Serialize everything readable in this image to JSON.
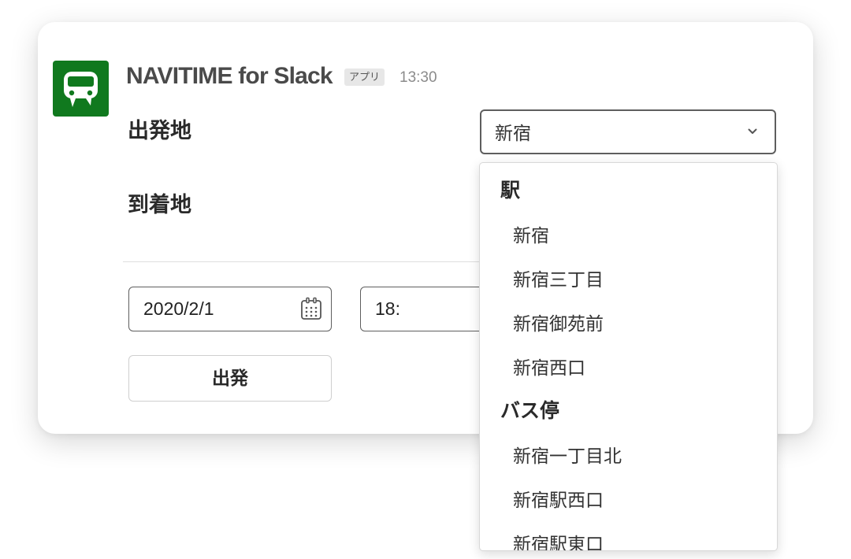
{
  "message": {
    "app_name": "NAVITIME for Slack",
    "app_badge": "アプリ",
    "timestamp": "13:30",
    "app_icon": "train-icon",
    "accent_color": "#10791e"
  },
  "form": {
    "departure_label": "出発地",
    "arrival_label": "到着地",
    "departure_select": {
      "value": "新宿",
      "icon": "chevron-down-icon"
    },
    "date_value": "2020/2/1",
    "date_icon": "calendar-icon",
    "time_value": "18:",
    "submit_label": "出発"
  },
  "dropdown": {
    "groups": [
      {
        "header": "駅",
        "options": [
          "新宿",
          "新宿三丁目",
          "新宿御苑前",
          "新宿西口"
        ]
      },
      {
        "header": "バス停",
        "options": [
          "新宿一丁目北",
          "新宿駅西口",
          "新宿駅東口"
        ]
      }
    ]
  }
}
